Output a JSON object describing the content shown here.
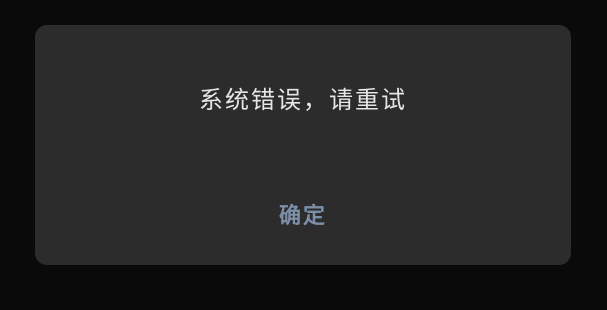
{
  "dialog": {
    "message": "系统错误，请重试",
    "confirm_label": "确定"
  },
  "colors": {
    "backdrop": "#0a0a0a",
    "dialog_background": "#2c2c2c",
    "message_text": "#e6e6e6",
    "confirm_text": "#7b8fa8"
  }
}
